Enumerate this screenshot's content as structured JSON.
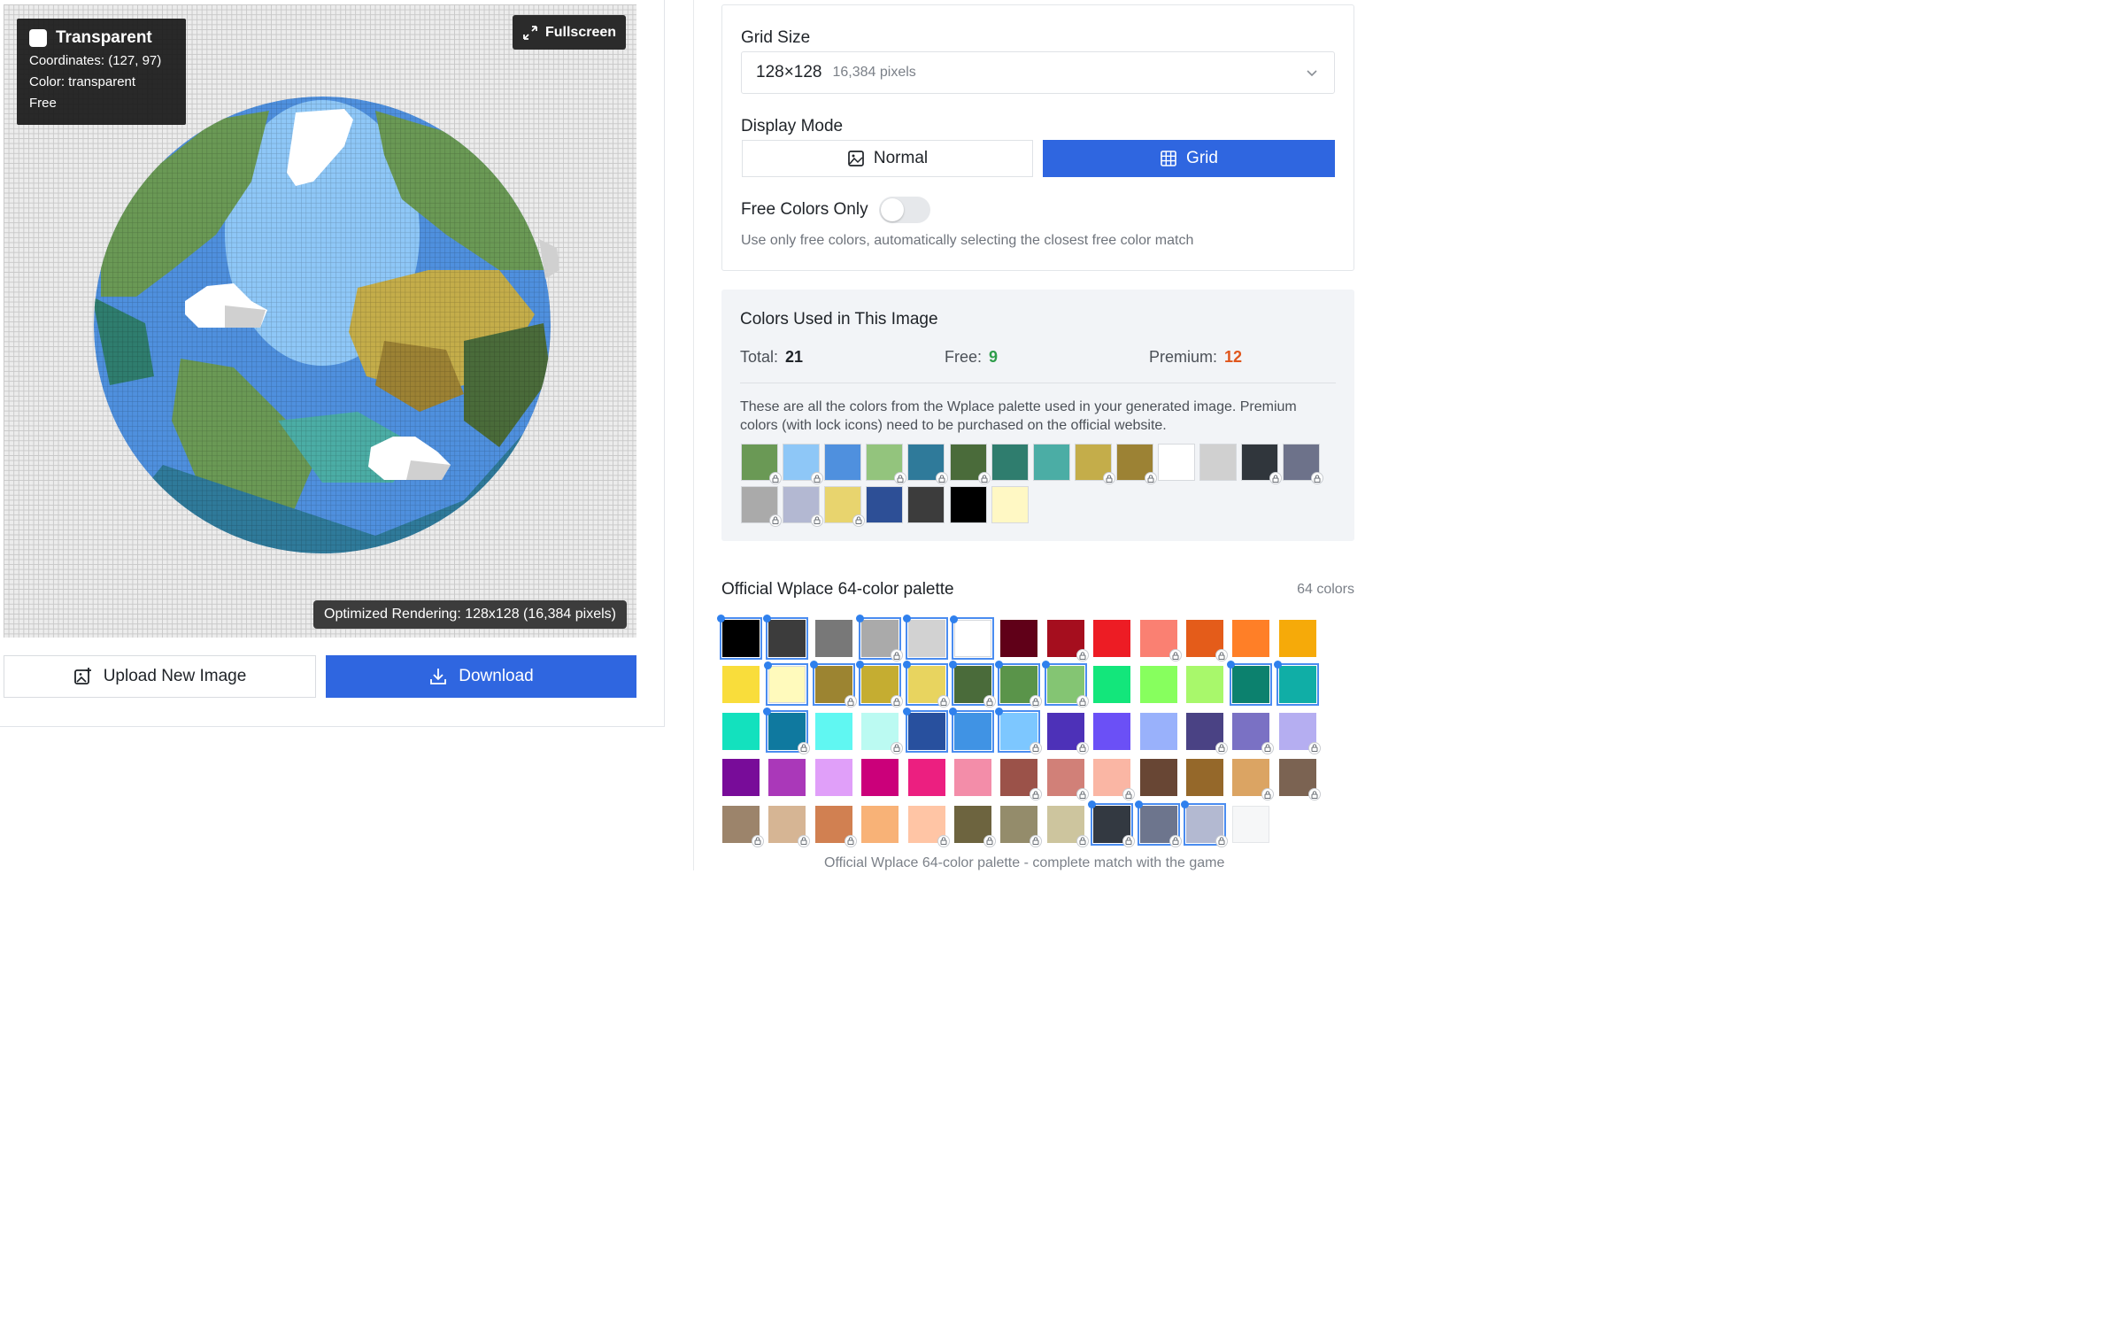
{
  "preview": {
    "tooltip": {
      "title": "Transparent",
      "coordinates": "Coordinates: (127, 97)",
      "color": "Color: transparent",
      "tier": "Free"
    },
    "fullscreen_label": "Fullscreen",
    "render_info": "Optimized Rendering: 128x128 (16,384 pixels)",
    "upload_label": "Upload New Image",
    "download_label": "Download"
  },
  "settings": {
    "grid_size_label": "Grid Size",
    "grid_size_value": "128×128",
    "grid_size_pixels": "16,384 pixels",
    "display_mode_label": "Display Mode",
    "mode_normal": "Normal",
    "mode_grid": "Grid",
    "selected_mode": "Grid",
    "free_colors_label": "Free Colors Only",
    "free_colors_enabled": false,
    "free_colors_hint": "Use only free colors, automatically selecting the closest free color match"
  },
  "colors_used": {
    "title": "Colors Used in This Image",
    "total_label": "Total:",
    "total": "21",
    "free_label": "Free:",
    "free": "9",
    "premium_label": "Premium:",
    "premium": "12",
    "description": "These are all the colors from the Wplace palette used in your generated image. Premium colors (with lock icons) need to be purchased on the official website.",
    "swatches": [
      {
        "hex": "#6a9955",
        "locked": true
      },
      {
        "hex": "#8ec7f7",
        "locked": true
      },
      {
        "hex": "#4f90de",
        "locked": false
      },
      {
        "hex": "#93c47d",
        "locked": true
      },
      {
        "hex": "#2f7a9a",
        "locked": true
      },
      {
        "hex": "#4a6b3a",
        "locked": true
      },
      {
        "hex": "#2f7d6e",
        "locked": false
      },
      {
        "hex": "#4bada5",
        "locked": false
      },
      {
        "hex": "#c4ad4a",
        "locked": true
      },
      {
        "hex": "#9c8234",
        "locked": true
      },
      {
        "hex": "#ffffff",
        "locked": false
      },
      {
        "hex": "#d0d0d0",
        "locked": false
      },
      {
        "hex": "#30363c",
        "locked": true
      },
      {
        "hex": "#6d728a",
        "locked": true
      },
      {
        "hex": "#aaaaaa",
        "locked": true
      },
      {
        "hex": "#b3b8d2",
        "locked": true
      },
      {
        "hex": "#e8d46e",
        "locked": true
      },
      {
        "hex": "#2d4f96",
        "locked": false
      },
      {
        "hex": "#3c3c3c",
        "locked": false
      },
      {
        "hex": "#000000",
        "locked": false
      },
      {
        "hex": "#fff8c4",
        "locked": false
      }
    ]
  },
  "palette": {
    "title": "Official Wplace 64-color palette",
    "count_label": "64 colors",
    "footer": "Official Wplace 64-color palette - complete match with the game",
    "swatches": [
      {
        "hex": "#000000",
        "locked": false,
        "selected": true
      },
      {
        "hex": "#3c3c3c",
        "locked": false,
        "selected": true
      },
      {
        "hex": "#787878",
        "locked": false,
        "selected": false
      },
      {
        "hex": "#aaaaaa",
        "locked": true,
        "selected": true
      },
      {
        "hex": "#d2d2d2",
        "locked": false,
        "selected": true
      },
      {
        "hex": "#ffffff",
        "locked": false,
        "selected": true
      },
      {
        "hex": "#600018",
        "locked": false,
        "selected": false
      },
      {
        "hex": "#a50e1e",
        "locked": true,
        "selected": false
      },
      {
        "hex": "#ed1c24",
        "locked": false,
        "selected": false
      },
      {
        "hex": "#fa8072",
        "locked": true,
        "selected": false
      },
      {
        "hex": "#e45c1a",
        "locked": true,
        "selected": false
      },
      {
        "hex": "#ff7f27",
        "locked": false,
        "selected": false
      },
      {
        "hex": "#f6aa09",
        "locked": false,
        "selected": false
      },
      {
        "hex": "#f9dd3b",
        "locked": false,
        "selected": false
      },
      {
        "hex": "#fffabc",
        "locked": false,
        "selected": true
      },
      {
        "hex": "#9c8431",
        "locked": true,
        "selected": true
      },
      {
        "hex": "#c5ad31",
        "locked": true,
        "selected": true
      },
      {
        "hex": "#e8d45f",
        "locked": true,
        "selected": true
      },
      {
        "hex": "#4a6b3a",
        "locked": true,
        "selected": true
      },
      {
        "hex": "#5a944a",
        "locked": true,
        "selected": true
      },
      {
        "hex": "#84c573",
        "locked": true,
        "selected": true
      },
      {
        "hex": "#13e67b",
        "locked": false,
        "selected": false
      },
      {
        "hex": "#87ff5e",
        "locked": false,
        "selected": false
      },
      {
        "hex": "#a8f86b",
        "locked": false,
        "selected": false
      },
      {
        "hex": "#0c816e",
        "locked": false,
        "selected": true
      },
      {
        "hex": "#10aea6",
        "locked": false,
        "selected": true
      },
      {
        "hex": "#13e1be",
        "locked": false,
        "selected": false
      },
      {
        "hex": "#0f799f",
        "locked": true,
        "selected": true
      },
      {
        "hex": "#60f7f2",
        "locked": false,
        "selected": false
      },
      {
        "hex": "#bbfaf2",
        "locked": true,
        "selected": false
      },
      {
        "hex": "#28509e",
        "locked": false,
        "selected": true
      },
      {
        "hex": "#4093e4",
        "locked": false,
        "selected": true
      },
      {
        "hex": "#7dc7ff",
        "locked": true,
        "selected": true
      },
      {
        "hex": "#4d31b8",
        "locked": true,
        "selected": false
      },
      {
        "hex": "#6b50f6",
        "locked": false,
        "selected": false
      },
      {
        "hex": "#99b1fb",
        "locked": false,
        "selected": false
      },
      {
        "hex": "#4a4284",
        "locked": true,
        "selected": false
      },
      {
        "hex": "#7a71c4",
        "locked": true,
        "selected": false
      },
      {
        "hex": "#b5aef1",
        "locked": true,
        "selected": false
      },
      {
        "hex": "#780c99",
        "locked": false,
        "selected": false
      },
      {
        "hex": "#aa38b9",
        "locked": false,
        "selected": false
      },
      {
        "hex": "#e09ff9",
        "locked": false,
        "selected": false
      },
      {
        "hex": "#cb007a",
        "locked": false,
        "selected": false
      },
      {
        "hex": "#ec1f80",
        "locked": false,
        "selected": false
      },
      {
        "hex": "#f38da9",
        "locked": false,
        "selected": false
      },
      {
        "hex": "#9b5249",
        "locked": true,
        "selected": false
      },
      {
        "hex": "#d18078",
        "locked": true,
        "selected": false
      },
      {
        "hex": "#fab6a4",
        "locked": true,
        "selected": false
      },
      {
        "hex": "#684634",
        "locked": false,
        "selected": false
      },
      {
        "hex": "#95682a",
        "locked": false,
        "selected": false
      },
      {
        "hex": "#dba463",
        "locked": true,
        "selected": false
      },
      {
        "hex": "#7b6352",
        "locked": true,
        "selected": false
      },
      {
        "hex": "#9c846b",
        "locked": true,
        "selected": false
      },
      {
        "hex": "#d6b594",
        "locked": true,
        "selected": false
      },
      {
        "hex": "#d18051",
        "locked": true,
        "selected": false
      },
      {
        "hex": "#f8b277",
        "locked": false,
        "selected": false
      },
      {
        "hex": "#ffc5a5",
        "locked": true,
        "selected": false
      },
      {
        "hex": "#6d643f",
        "locked": true,
        "selected": false
      },
      {
        "hex": "#948c6b",
        "locked": true,
        "selected": false
      },
      {
        "hex": "#cdc59e",
        "locked": true,
        "selected": false
      },
      {
        "hex": "#333941",
        "locked": true,
        "selected": true
      },
      {
        "hex": "#6d758d",
        "locked": true,
        "selected": true
      },
      {
        "hex": "#b3b9d1",
        "locked": true,
        "selected": true
      },
      {
        "hex": "transparent",
        "locked": false,
        "selected": false
      }
    ]
  }
}
